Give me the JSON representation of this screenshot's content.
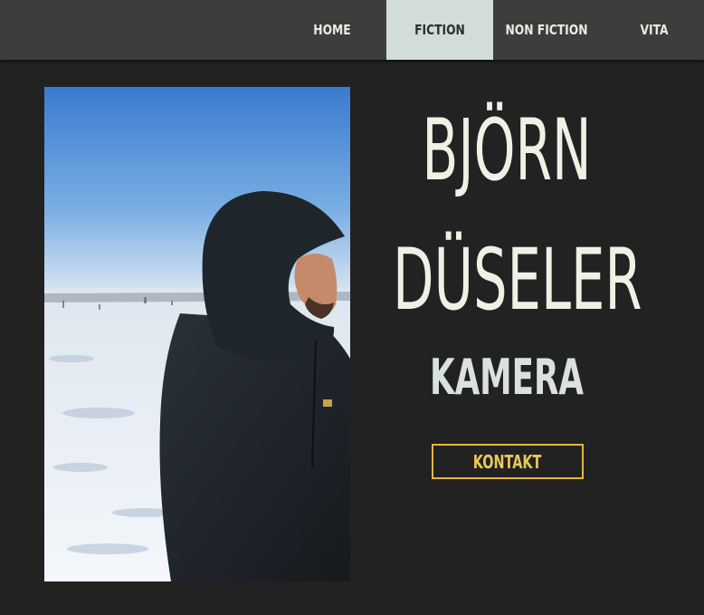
{
  "nav": {
    "items": [
      {
        "label": "HOME",
        "active": false
      },
      {
        "label": "FICTION",
        "active": true
      },
      {
        "label": "NON FICTION",
        "active": false
      },
      {
        "label": "VITA",
        "active": false
      }
    ]
  },
  "hero": {
    "first_name": "BJÖRN",
    "last_name": "DÜSELER",
    "role": "KAMERA",
    "contact_label": "KONTAKT"
  },
  "colors": {
    "background": "#222222",
    "nav_bg": "#3b3e3a",
    "nav_active_bg": "#d3ddd7",
    "headline": "#eef1e4",
    "accent": "#e3b73c"
  }
}
